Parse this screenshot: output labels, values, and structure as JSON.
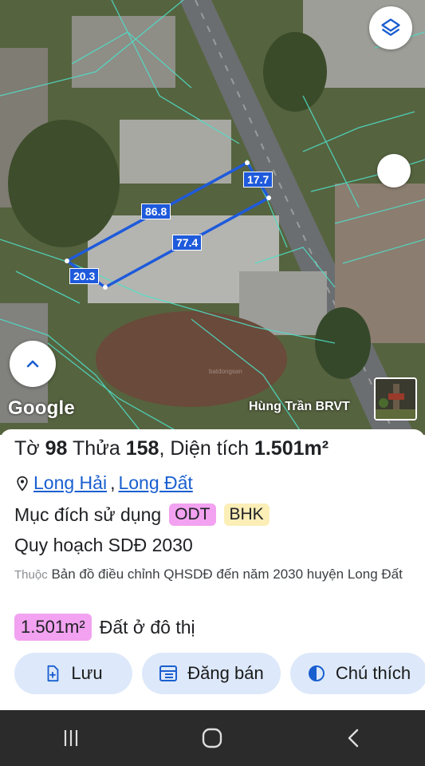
{
  "map": {
    "google_logo": "Google",
    "image_credit": "Hùng Trần BRVT",
    "dimensions": [
      "17.7",
      "86.8",
      "77.4",
      "20.3"
    ]
  },
  "parcel": {
    "title_prefix": "Tờ",
    "sheet_no": "98",
    "plot_label": "Thửa",
    "plot_no": "158",
    "area_label": ", Diện tích",
    "area_value": "1.501m²",
    "commune": "Long Hải",
    "district": "Long Đất",
    "purpose_label": "Mục đích sử dụng",
    "purpose_tags": [
      "ODT",
      "BHK"
    ],
    "plan_title": "Quy hoạch SDĐ 2030",
    "source_label": "Thuộc",
    "source_text": "Bản đồ điều chỉnh QHSDĐ đến năm 2030 huyện Long Đất",
    "land_area": "1.501m²",
    "land_type": "Đất ở đô thị"
  },
  "actions": {
    "save": "Lưu",
    "post_sale": "Đăng bán",
    "legend": "Chú thích"
  },
  "colors": {
    "accent": "#1a5fd0",
    "odt_tag": "#f2a2f0",
    "bhk_tag": "#fbeeb7",
    "button_bg": "#dde9fa",
    "parcel_line": "#1e5adb"
  }
}
